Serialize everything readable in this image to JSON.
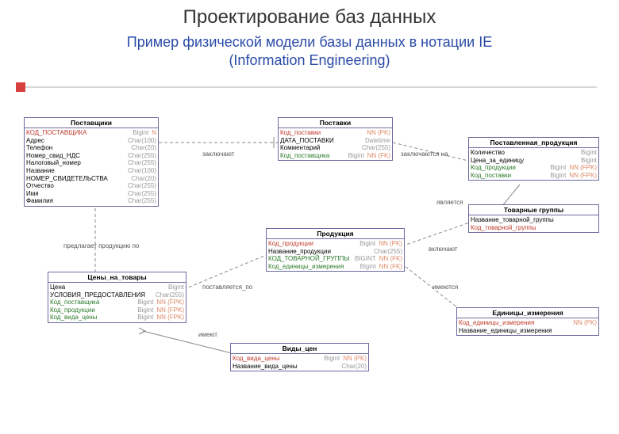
{
  "title": "Проектирование баз данных",
  "subtitle_l1": "Пример физической модели базы данных в нотации IE",
  "subtitle_l2": "(Information Engineering)",
  "entities": {
    "suppliers": {
      "name": "Поставщики",
      "rows": [
        {
          "k": "pk",
          "n": "КОД_ПОСТАВЩИКА",
          "t": "Bigint",
          "f": "N"
        },
        {
          "k": "",
          "n": "Адрес",
          "t": "Char(100)",
          "f": ""
        },
        {
          "k": "",
          "n": "Телефон",
          "t": "Char(20)",
          "f": ""
        },
        {
          "k": "",
          "n": "Номер_свид_НДС",
          "t": "Char(255)",
          "f": ""
        },
        {
          "k": "",
          "n": "Налоговый_номер",
          "t": "Char(255)",
          "f": ""
        },
        {
          "k": "",
          "n": "Название",
          "t": "Char(100)",
          "f": ""
        },
        {
          "k": "",
          "n": "НОМЕР_СВИДЕТЕЛЬСТВА",
          "t": "Char(20)",
          "f": ""
        },
        {
          "k": "",
          "n": "Отчество",
          "t": "Char(255)",
          "f": ""
        },
        {
          "k": "",
          "n": "Имя",
          "t": "Char(255)",
          "f": ""
        },
        {
          "k": "",
          "n": "Фамилия",
          "t": "Char(255)",
          "f": ""
        }
      ]
    },
    "supplies": {
      "name": "Поставки",
      "rows": [
        {
          "k": "pk",
          "n": "Код_поставки",
          "t": "",
          "f": "NN (PK)"
        },
        {
          "k": "",
          "n": "ДАТА_ПОСТАВКИ",
          "t": "Datetime",
          "f": ""
        },
        {
          "k": "",
          "n": "Комментарий",
          "t": "Char(255)",
          "f": ""
        },
        {
          "k": "fk",
          "n": "Код_поставщика",
          "t": "Bigint",
          "f": "NN (FK)"
        }
      ]
    },
    "supplied_products": {
      "name": "Поставленная_продукция",
      "rows": [
        {
          "k": "",
          "n": "Количество",
          "t": "Bigint",
          "f": ""
        },
        {
          "k": "",
          "n": "Цена_за_единицу",
          "t": "Bigint",
          "f": ""
        },
        {
          "k": "fk",
          "n": "Код_продукции",
          "t": "Bigint",
          "f": "NN (FPK)"
        },
        {
          "k": "fk",
          "n": "Код_поставки",
          "t": "Bigint",
          "f": "NN (FPK)"
        }
      ]
    },
    "product_groups": {
      "name": "Товарные группы",
      "rows": [
        {
          "k": "",
          "n": "Название_товарной_группы",
          "t": "",
          "f": ""
        },
        {
          "k": "pk",
          "n": "Код_товарной_группы",
          "t": "",
          "f": ""
        }
      ]
    },
    "products": {
      "name": "Продукция",
      "rows": [
        {
          "k": "pk",
          "n": "Код_продукции",
          "t": "Bigint",
          "f": "NN (PK)"
        },
        {
          "k": "",
          "n": "Название_продукции",
          "t": "Char(255)",
          "f": ""
        },
        {
          "k": "fk",
          "n": "КОД_ТОВАРНОЙ_ГРУППЫ",
          "t": "BIGINT",
          "f": "NN (FK)"
        },
        {
          "k": "fk",
          "n": "Код_единицы_измерения",
          "t": "Bigint",
          "f": "NN (FK)"
        }
      ]
    },
    "prices": {
      "name": "Цены_на_товары",
      "rows": [
        {
          "k": "",
          "n": "Цена",
          "t": "Bigint",
          "f": ""
        },
        {
          "k": "",
          "n": "УСЛОВИЯ_ПРЕДОСТАВЛЕНИЯ",
          "t": "Char(255)",
          "f": ""
        },
        {
          "k": "fk",
          "n": "Код_поставщика",
          "t": "Bigint",
          "f": "NN (FPK)"
        },
        {
          "k": "fk",
          "n": "Код_продукции",
          "t": "Bigint",
          "f": "NN (FPK)"
        },
        {
          "k": "fk",
          "n": "Код_вида_цены",
          "t": "Bigint",
          "f": "NN (FPK)"
        }
      ]
    },
    "units": {
      "name": "Единицы_измерения",
      "rows": [
        {
          "k": "pk",
          "n": "Код_единицы_измерения",
          "t": "",
          "f": "NN (PK)"
        },
        {
          "k": "",
          "n": "Название_единицы_измерения",
          "t": "",
          "f": ""
        }
      ]
    },
    "price_types": {
      "name": "Виды_цен",
      "rows": [
        {
          "k": "pk",
          "n": "Код_вида_цены",
          "t": "Bigint",
          "f": "NN (PK)"
        },
        {
          "k": "",
          "n": "Название_вида_цены",
          "t": "Char(20)",
          "f": ""
        }
      ]
    }
  },
  "relations": {
    "r1": "заключают",
    "r2": "заключаются на",
    "r3": "является",
    "r4": "предлагает продукцию по",
    "r5": "поставляется_по",
    "r6": "включают",
    "r7": "имеются",
    "r8": "имеют"
  }
}
